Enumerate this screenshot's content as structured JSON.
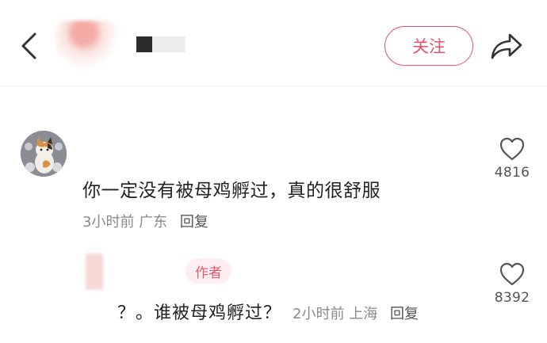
{
  "header": {
    "follow_label": "关注"
  },
  "comments": [
    {
      "text": "你一定没有被母鸡孵过，真的很舒服",
      "time": "3小时前",
      "location": "广东",
      "reply_label": "回复",
      "likes": "4816"
    }
  ],
  "reply": {
    "badge": "作者",
    "text": "？。谁被母鸡孵过？",
    "time": "2小时前",
    "location": "上海",
    "reply_label": "回复",
    "likes": "8392"
  },
  "colors": {
    "accent": "#e8506e",
    "meta_text": "#8a8a8a"
  },
  "icons": [
    "back-arrow-icon",
    "share-icon",
    "heart-icon"
  ]
}
